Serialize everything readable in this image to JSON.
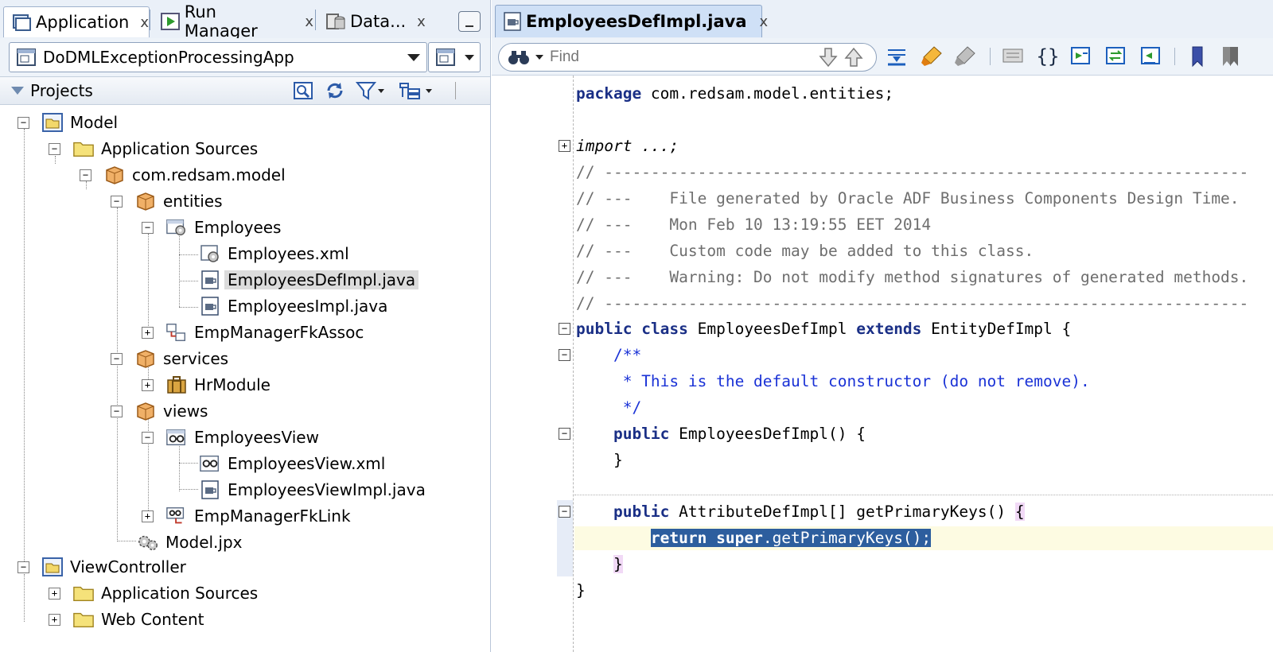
{
  "left_tabs": [
    {
      "label": "Application",
      "close": "x"
    },
    {
      "label": "Run Manager",
      "close": "x"
    },
    {
      "label": "Data...",
      "close": "x"
    }
  ],
  "app_selector": {
    "value": "DoDMLExceptionProcessingApp"
  },
  "projects_panel": {
    "title": "Projects"
  },
  "tree": [
    {
      "label": "Model"
    },
    {
      "label": "Application Sources"
    },
    {
      "label": "com.redsam.model"
    },
    {
      "label": "entities"
    },
    {
      "label": "Employees"
    },
    {
      "label": "Employees.xml"
    },
    {
      "label": "EmployeesDefImpl.java"
    },
    {
      "label": "EmployeesImpl.java"
    },
    {
      "label": "EmpManagerFkAssoc"
    },
    {
      "label": "services"
    },
    {
      "label": "HrModule"
    },
    {
      "label": "views"
    },
    {
      "label": "EmployeesView"
    },
    {
      "label": "EmployeesView.xml"
    },
    {
      "label": "EmployeesViewImpl.java"
    },
    {
      "label": "EmpManagerFkLink"
    },
    {
      "label": "Model.jpx"
    },
    {
      "label": "ViewController"
    },
    {
      "label": "Application Sources"
    },
    {
      "label": "Web Content"
    }
  ],
  "editor_tab": {
    "label": "EmployeesDefImpl.java",
    "close": "x"
  },
  "find": {
    "placeholder": "Find"
  },
  "code": {
    "package_kw": "package",
    "package_name": " com.redsam.model.entities;",
    "import_line": "import ...;",
    "comment_rule": "// ---------------------------------------------------------------------",
    "comment_1": "// ---    File generated by Oracle ADF Business Components Design Time.",
    "comment_2": "// ---    Mon Feb 10 13:19:55 EET 2014",
    "comment_3": "// ---    Custom code may be added to this class.",
    "comment_4": "// ---    Warning: Do not modify method signatures of generated methods.",
    "class_kw1": "public",
    "class_kw2": "class",
    "class_name": " EmployeesDefImpl ",
    "class_kw3": "extends",
    "class_rest": " EntityDefImpl {",
    "jd_open": "    /**",
    "jd_text": "     * This is the default constructor (do not remove).",
    "jd_close": "     */",
    "ctor_kw": "public",
    "ctor_rest": " EmployeesDefImpl() {",
    "ctor_close": "    }",
    "method_kw": "public",
    "method_rest": " AttributeDefImpl[] getPrimaryKeys() ",
    "method_brace": "{",
    "return_kw": "return",
    "super_kw": "super",
    "return_rest": ".getPrimaryKeys();",
    "method_close": "}",
    "class_close": "}"
  },
  "colors": {
    "keyword": "#1a2f86",
    "javadoc": "#1a32d6",
    "comment": "#6e6e6e",
    "selection": "#2d5e9e"
  }
}
